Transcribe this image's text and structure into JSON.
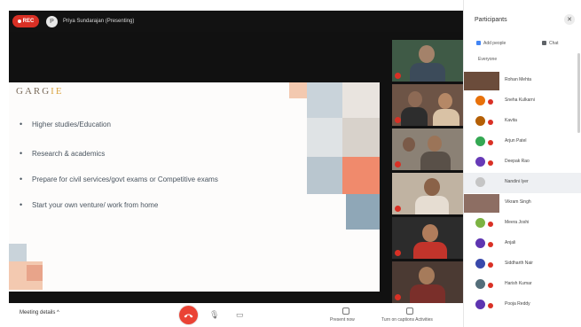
{
  "recording": {
    "label": "REC"
  },
  "presenter": {
    "avatar_initial": "P",
    "text": "Priya Sundarajan (Presenting)"
  },
  "slide": {
    "logo_prefix": "GARG",
    "logo_accent": "IE",
    "bullets": [
      "Higher studies/Education",
      "Research & academics",
      "Prepare for civil services/govt exams or Competitive exams",
      "Start your own venture/ work from home"
    ]
  },
  "controls": {
    "meeting_details": "Meeting details  ^",
    "present_label": "Present now",
    "activities_label": "Turn on captions  Activities",
    "mic_glyph": "🎙",
    "cam_glyph": "▭"
  },
  "panel": {
    "title": "Participants",
    "close_glyph": "✕",
    "tab_add": "Add people",
    "tab_chat": "Chat",
    "tab_people": "Everyone",
    "participants": [
      {
        "name": "Rohan Mehta",
        "color": "#6b4c3b"
      },
      {
        "name": "Sneha Kulkarni",
        "color": "#e8710a"
      },
      {
        "name": "Kavita",
        "color": "#b45f06"
      },
      {
        "name": "Arjun Patel",
        "color": "#34a853"
      },
      {
        "name": "Deepak Rao",
        "color": "#673ab7"
      },
      {
        "name": "Nandini Iyer",
        "color": "#c5c5c5"
      },
      {
        "name": "Vikram Singh",
        "color": "#8d6e63"
      },
      {
        "name": "Meera Joshi",
        "color": "#7cb342"
      },
      {
        "name": "Anjali",
        "color": "#5e35b1"
      },
      {
        "name": "Siddharth Nair",
        "color": "#3949ab"
      },
      {
        "name": "Harish Kumar",
        "color": "#546e7a"
      },
      {
        "name": "Pooja Reddy",
        "color": "#5e35b1"
      }
    ]
  },
  "colors": {
    "accent_red": "#ea4335",
    "stage_bg": "#111111",
    "slide_bg": "#fdfcfb"
  }
}
